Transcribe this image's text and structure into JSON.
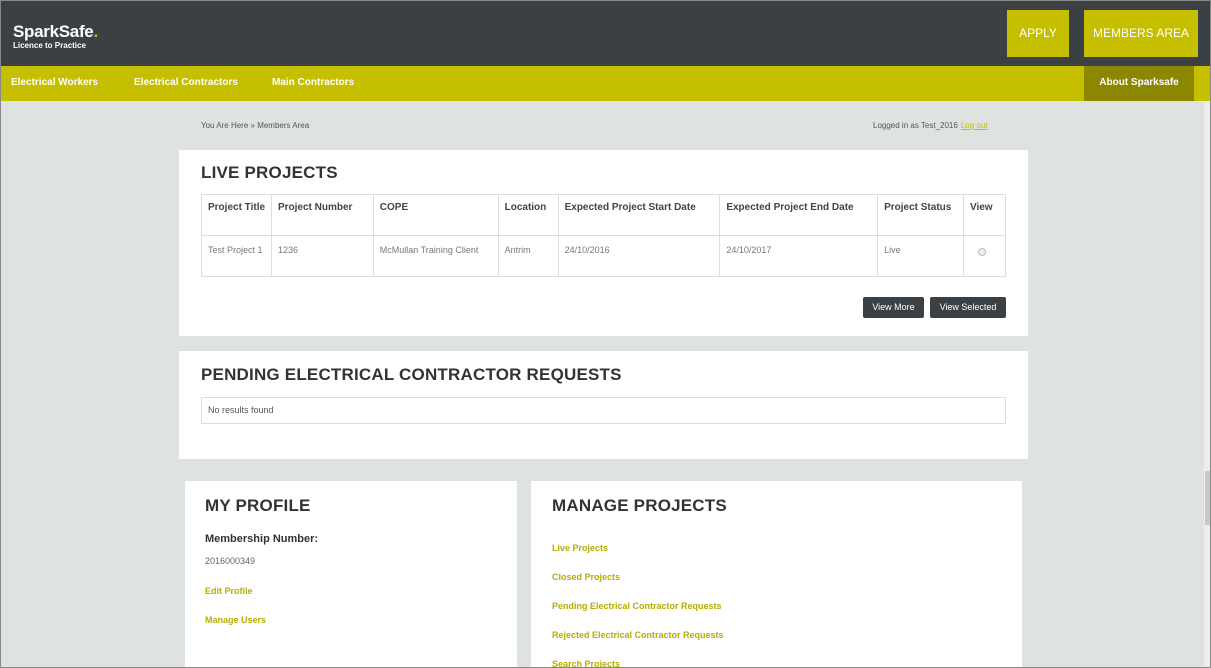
{
  "header": {
    "logo_main": "SparkSafe",
    "logo_dot": ".",
    "logo_sub": "Licence to Practice",
    "apply_label": "APPLY",
    "members_label": "MEMBERS AREA"
  },
  "nav": {
    "items": [
      "Electrical Workers",
      "Electrical Contractors",
      "Main Contractors"
    ],
    "about": "About Sparksafe"
  },
  "breadcrumb": "You Are Here » Members Area",
  "login": {
    "text": "Logged in as Test_2016",
    "logout": "Log out"
  },
  "live_projects": {
    "title": "LIVE PROJECTS",
    "columns": [
      "Project Title",
      "Project Number",
      "COPE",
      "Location",
      "Expected Project Start Date",
      "Expected Project End Date",
      "Project Status",
      "View"
    ],
    "rows": [
      [
        "Test Project 1",
        "1236",
        "McMullan Training Client",
        "Antrim",
        "24/10/2016",
        "24/10/2017",
        "Live",
        ""
      ]
    ],
    "view_more": "View More",
    "view_selected": "View Selected"
  },
  "pending": {
    "title": "PENDING ELECTRICAL CONTRACTOR REQUESTS",
    "empty_text": "No results found"
  },
  "profile": {
    "title": "MY PROFILE",
    "membership_label": "Membership Number:",
    "membership_number": "2016000349",
    "edit_profile": "Edit Profile",
    "manage_users": "Manage Users"
  },
  "manage_projects": {
    "title": "MANAGE PROJECTS",
    "links": [
      "Live Projects",
      "Closed Projects",
      "Pending Electrical Contractor Requests",
      "Rejected Electrical Contractor Requests",
      "Search Projects"
    ]
  },
  "colors": {
    "brand_yellow": "#c6bf00",
    "dark_bar": "#3b4044",
    "page_bg": "#dfe3df"
  }
}
